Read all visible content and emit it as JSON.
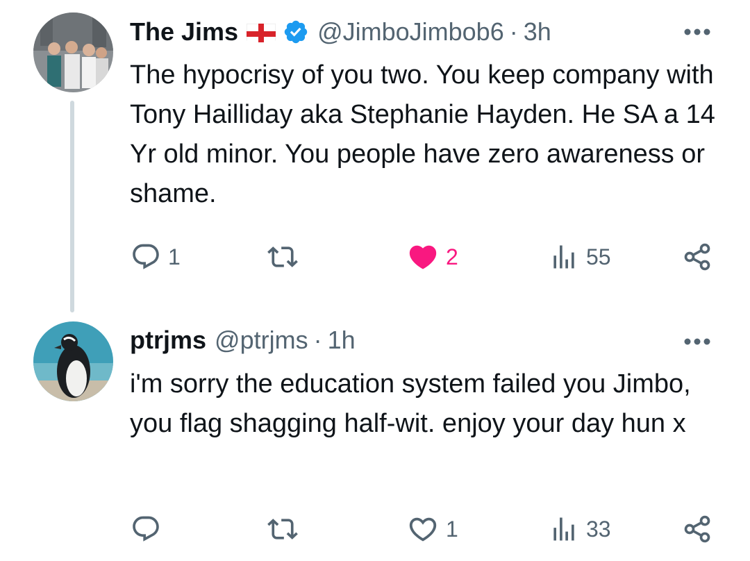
{
  "tweets": [
    {
      "author_name": "The Jims",
      "flag_icon": "england-flag-icon",
      "verified_icon": "verified-badge-icon",
      "handle": "@JimboJimbob6",
      "separator": "·",
      "time": "3h",
      "text": "The hypocrisy of you two. You keep company with Tony Hailliday aka Stephanie Hayden. He SA a 14 Yr old minor. You people have zero awareness or shame.",
      "replies": "1",
      "retweets": "",
      "likes": "2",
      "liked": true,
      "views": "55",
      "like_color": "#f91880"
    },
    {
      "author_name": "ptrjms",
      "handle": "@ptrjms",
      "separator": "·",
      "time": "1h",
      "text": "i'm sorry the education system failed you Jimbo, you flag shagging half-wit. enjoy your day hun x",
      "replies": "",
      "retweets": "",
      "likes": "1",
      "liked": false,
      "views": "33"
    }
  ],
  "colors": {
    "text": "#0f1419",
    "secondary": "#536471",
    "verified": "#1d9bf0",
    "thread_line": "#cfd9de",
    "like_active": "#f91880"
  },
  "icons": {
    "reply": "reply-bubble-icon",
    "retweet": "retweet-icon",
    "like": "heart-icon",
    "views": "views-bar-chart-icon",
    "share": "share-icon",
    "more": "more-dots-icon"
  }
}
